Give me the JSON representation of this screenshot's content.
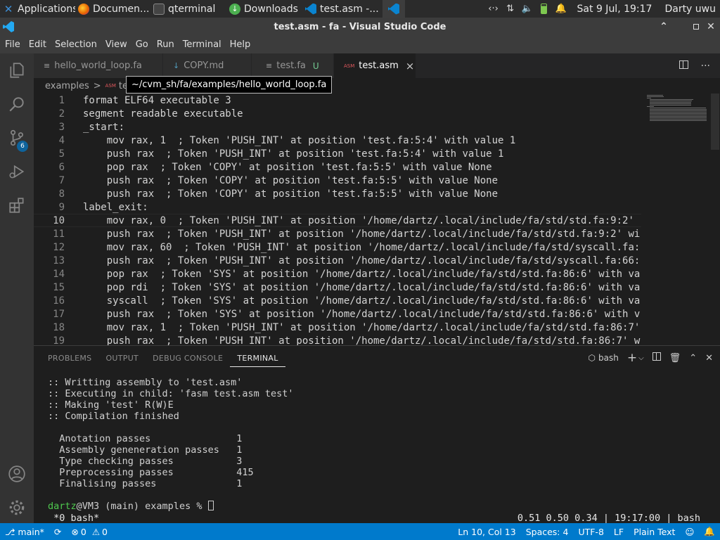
{
  "panel": {
    "items": [
      {
        "label": "Applications",
        "icon": "xfce-icon",
        "color": "#3d8fd6"
      },
      {
        "label": "Documen...",
        "icon": "firefox-icon",
        "color": "#e66000"
      },
      {
        "label": "qterminal",
        "icon": "terminal-icon",
        "color": "#444444"
      },
      {
        "label": "Downloads",
        "icon": "downloads-icon",
        "color": "#4caf50"
      },
      {
        "label": "test.asm -...",
        "icon": "vscode-icon",
        "color": "#0a84d0"
      }
    ],
    "clock": "Sat  9 Jul, 19:17",
    "user": "Darty uwu"
  },
  "window": {
    "title": "test.asm - fa - Visual Studio Code"
  },
  "menu": [
    "File",
    "Edit",
    "Selection",
    "View",
    "Go",
    "Run",
    "Terminal",
    "Help"
  ],
  "activity": {
    "scm_badge": "6"
  },
  "tabs": [
    {
      "label": "hello_world_loop.fa",
      "icon": "file-icon",
      "status": ""
    },
    {
      "label": "COPY.md",
      "icon": "markdown-icon",
      "status": ""
    },
    {
      "label": "test.fa",
      "icon": "file-icon",
      "status": "U"
    },
    {
      "label": "test.asm",
      "icon": "asm-icon",
      "status": "×"
    }
  ],
  "breadcrumb": {
    "folder": "examples",
    "separator": ">",
    "file": "te"
  },
  "tooltip": "~/cvm_sh/fa/examples/hello_world_loop.fa",
  "editor": {
    "current_line": 10,
    "lines": [
      {
        "n": "1",
        "text": "format ELF64 executable 3"
      },
      {
        "n": "2",
        "text": "segment readable executable"
      },
      {
        "n": "3",
        "text": "_start:"
      },
      {
        "n": "4",
        "text": "    mov rax, 1  ; Token 'PUSH_INT' at position 'test.fa:5:4' with value 1"
      },
      {
        "n": "5",
        "text": "    push rax  ; Token 'PUSH_INT' at position 'test.fa:5:4' with value 1"
      },
      {
        "n": "6",
        "text": "    pop rax  ; Token 'COPY' at position 'test.fa:5:5' with value None"
      },
      {
        "n": "7",
        "text": "    push rax  ; Token 'COPY' at position 'test.fa:5:5' with value None"
      },
      {
        "n": "8",
        "text": "    push rax  ; Token 'COPY' at position 'test.fa:5:5' with value None"
      },
      {
        "n": "9",
        "text": "label_exit:"
      },
      {
        "n": "10",
        "text": "    mov rax, 0  ; Token 'PUSH_INT' at position '/home/dartz/.local/include/fa/std/std.fa:9:2'"
      },
      {
        "n": "11",
        "text": "    push rax  ; Token 'PUSH_INT' at position '/home/dartz/.local/include/fa/std/std.fa:9:2' wi"
      },
      {
        "n": "12",
        "text": "    mov rax, 60  ; Token 'PUSH_INT' at position '/home/dartz/.local/include/fa/std/syscall.fa:"
      },
      {
        "n": "13",
        "text": "    push rax  ; Token 'PUSH_INT' at position '/home/dartz/.local/include/fa/std/syscall.fa:66:"
      },
      {
        "n": "14",
        "text": "    pop rax  ; Token 'SYS' at position '/home/dartz/.local/include/fa/std/std.fa:86:6' with va"
      },
      {
        "n": "15",
        "text": "    pop rdi  ; Token 'SYS' at position '/home/dartz/.local/include/fa/std/std.fa:86:6' with va"
      },
      {
        "n": "16",
        "text": "    syscall  ; Token 'SYS' at position '/home/dartz/.local/include/fa/std/std.fa:86:6' with va"
      },
      {
        "n": "17",
        "text": "    push rax  ; Token 'SYS' at position '/home/dartz/.local/include/fa/std/std.fa:86:6' with v"
      },
      {
        "n": "18",
        "text": "    mov rax, 1  ; Token 'PUSH_INT' at position '/home/dartz/.local/include/fa/std/std.fa:86:7'"
      },
      {
        "n": "19",
        "text": "    push rax  ; Token 'PUSH_INT' at position '/home/dartz/.local/include/fa/std/std.fa:86:7' w"
      }
    ]
  },
  "bottom_panel": {
    "tabs": [
      "PROBLEMS",
      "OUTPUT",
      "DEBUG CONSOLE",
      "TERMINAL"
    ],
    "active_tab": "TERMINAL",
    "shell": "bash"
  },
  "terminal": {
    "lines": [
      ":: Writting assembly to 'test.asm'",
      ":: Executing in child: 'fasm test.asm test'",
      ":: Making 'test' R(W)E",
      ":: Compilation finished",
      "",
      "  Anotation passes               1",
      "  Assembly geneneration passes   1",
      "  Type checking passes           3",
      "  Preprocessing passes           415",
      "  Finalising passes              1",
      ""
    ],
    "prompt_user": "dartz",
    "prompt_rest": "@VM3 (main) examples % ",
    "tmux_left": " *0 bash*",
    "tmux_right": "0.51 0.50 0.34 | 19:17:00 | bash"
  },
  "status": {
    "branch": "main*",
    "errors": "0",
    "warnings": "0",
    "position": "Ln 10, Col 13",
    "spaces": "Spaces: 4",
    "encoding": "UTF-8",
    "eol": "LF",
    "language": "Plain Text"
  },
  "colors": {
    "accent": "#007acc",
    "prompt_user": "#4ec94e"
  }
}
